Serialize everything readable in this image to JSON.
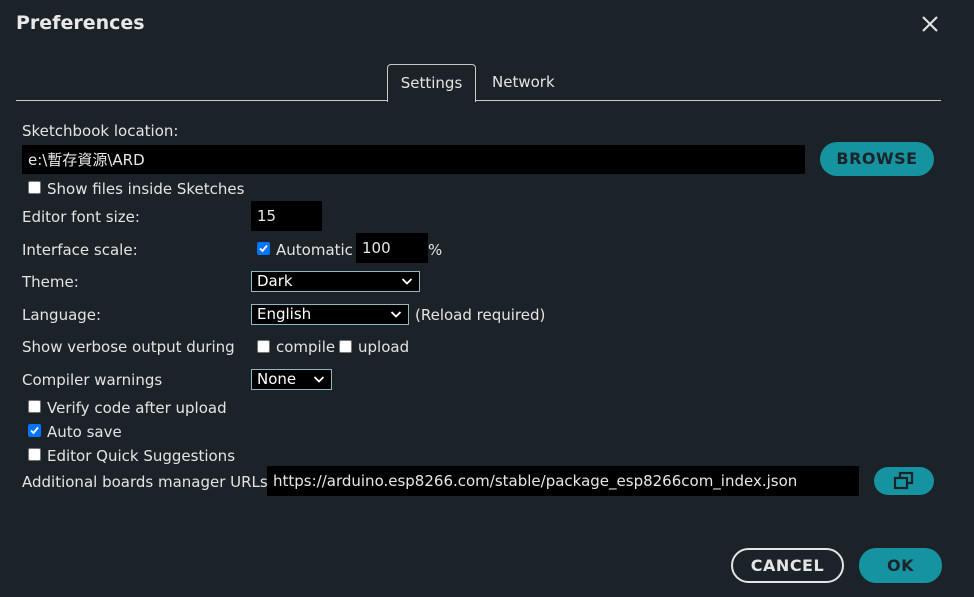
{
  "dialog": {
    "title": "Preferences",
    "close_icon": "close-icon"
  },
  "tabs": [
    {
      "label": "Settings",
      "active": true
    },
    {
      "label": "Network",
      "active": false
    }
  ],
  "settings": {
    "sketchbook_label": "Sketchbook location:",
    "sketchbook_value": "e:\\暫存資源\\ARD",
    "browse_label": "BROWSE",
    "show_files_label": "Show files inside Sketches",
    "show_files_checked": false,
    "font_size_label": "Editor font size:",
    "font_size_value": "15",
    "interface_scale_label": "Interface scale:",
    "automatic_label": "Automatic",
    "automatic_checked": true,
    "scale_value": "100",
    "scale_unit": "%",
    "theme_label": "Theme:",
    "theme_value": "Dark",
    "language_label": "Language:",
    "language_value": "English",
    "reload_note": "(Reload required)",
    "verbose_label": "Show verbose output during",
    "compile_label": "compile",
    "compile_checked": false,
    "upload_label": "upload",
    "upload_checked": false,
    "compiler_warnings_label": "Compiler warnings",
    "compiler_warnings_value": "None",
    "verify_label": "Verify code after upload",
    "verify_checked": false,
    "autosave_label": "Auto save",
    "autosave_checked": true,
    "quick_suggestions_label": "Editor Quick Suggestions",
    "quick_suggestions_checked": false,
    "boards_urls_label": "Additional boards manager URLs:",
    "boards_urls_value": "https://arduino.esp8266.com/stable/package_esp8266com_index.json",
    "open_window_icon": "open-in-window-icon"
  },
  "footer": {
    "cancel_label": "CANCEL",
    "ok_label": "OK"
  },
  "colors": {
    "background": "#1b2329",
    "accent": "#1593a0",
    "input_bg": "#000000",
    "checkbox_checked": "#0075ff"
  }
}
